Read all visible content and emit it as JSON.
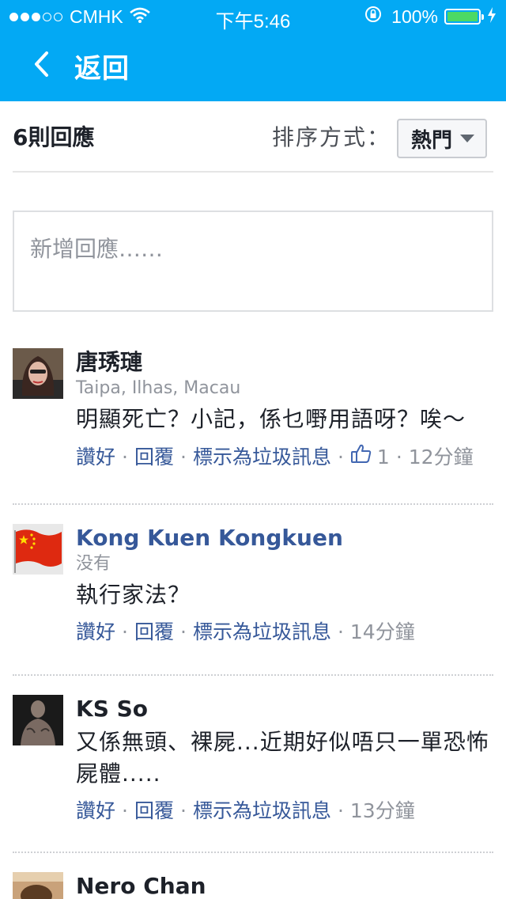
{
  "status_bar": {
    "carrier": "CMHK",
    "time": "下午5:46",
    "battery_percent": "100%",
    "colors": {
      "bar": "#03a9f4",
      "battery": "#4cd964"
    }
  },
  "nav": {
    "back_label": "返回"
  },
  "header": {
    "count": "6則回應",
    "sort_label": "排序方式：",
    "sort_value": "熱門"
  },
  "composer": {
    "placeholder": "新增回應……"
  },
  "actions": {
    "like": "讚好",
    "reply": "回覆",
    "spam": "標示為垃圾訊息",
    "dot": "·"
  },
  "comments": [
    {
      "author": "唐琇璉",
      "location": "Taipa, Ilhas, Macau",
      "text": "明顯死亡？小記，係乜嘢用語呀？唉～",
      "likes": "1",
      "time": "12分鐘"
    },
    {
      "author": "Kong Kuen Kongkuen",
      "location": "没有",
      "text": "執行家法？",
      "time": "14分鐘"
    },
    {
      "author": "KS So",
      "text": "又係無頭、裸屍...近期好似唔只一單恐怖屍體.....",
      "time": "13分鐘"
    },
    {
      "author": "Nero Chan"
    }
  ],
  "icons": [
    "back-chevron-icon",
    "wifi-icon",
    "rotation-lock-icon",
    "battery-icon",
    "charging-bolt-icon",
    "thumbs-up-icon",
    "dropdown-caret-icon"
  ],
  "accent_color": "#365899"
}
